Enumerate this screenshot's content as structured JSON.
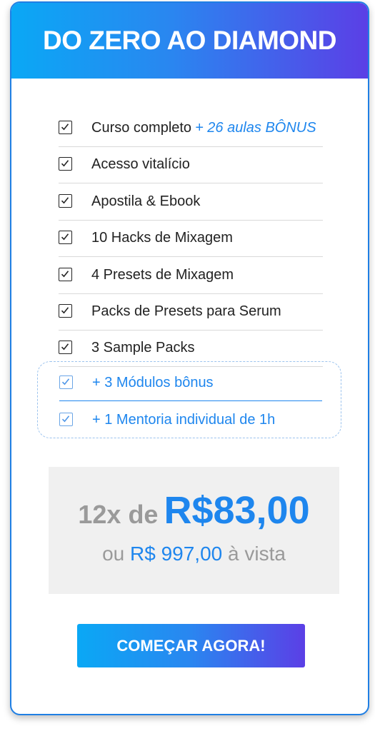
{
  "header": {
    "title": "DO ZERO AO DIAMOND"
  },
  "features": [
    {
      "label": "Curso completo",
      "highlight": "+ 26 aulas BÔNUS"
    },
    {
      "label": "Acesso vitalício",
      "highlight": ""
    },
    {
      "label": "Apostila & Ebook",
      "highlight": ""
    },
    {
      "label": "10 Hacks de Mixagem",
      "highlight": ""
    },
    {
      "label": "4 Presets de Mixagem",
      "highlight": ""
    },
    {
      "label": "Packs de Presets para Serum",
      "highlight": ""
    },
    {
      "label": "3 Sample Packs",
      "highlight": ""
    }
  ],
  "bonus": [
    {
      "label": "+ 3 Módulos bônus"
    },
    {
      "label": "+ 1 Mentoria individual de 1h"
    }
  ],
  "pricing": {
    "installments": "12x de",
    "installment_price": "R$83,00",
    "cash_prefix": "ou",
    "cash_price": "R$ 997,00",
    "cash_suffix": "à vista"
  },
  "cta": {
    "label": "COMEÇAR AGORA!"
  },
  "colors": {
    "accent": "#1e86ee",
    "gradient_start": "#0aa8f5",
    "gradient_end": "#5b3fe6",
    "muted_text": "#9a9a9a",
    "price_bg": "#f0f0f0"
  }
}
